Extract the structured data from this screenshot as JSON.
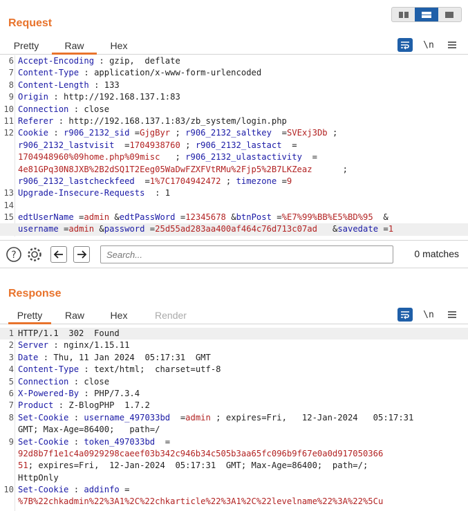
{
  "layout": {
    "icons": [
      "columns-icon",
      "rows-icon",
      "single-pane-icon"
    ]
  },
  "request": {
    "title": "Request",
    "tabs": [
      "Pretty",
      "Raw",
      "Hex"
    ],
    "active_tab": "Raw",
    "tools": {
      "newline": "\\n"
    },
    "lines": [
      {
        "n": "6",
        "parts": [
          [
            "hn",
            "Accept-Encoding"
          ],
          [
            "val",
            " : gzip,  deflate"
          ]
        ]
      },
      {
        "n": "7",
        "parts": [
          [
            "hn",
            "Content-Type"
          ],
          [
            "val",
            " : application/x-www-form-urlencoded"
          ]
        ]
      },
      {
        "n": "8",
        "parts": [
          [
            "hn",
            "Content-Length"
          ],
          [
            "val",
            " : 133"
          ]
        ]
      },
      {
        "n": "9",
        "parts": [
          [
            "hn",
            "Origin"
          ],
          [
            "val",
            " : http://192.168.137.1:83"
          ]
        ]
      },
      {
        "n": "10",
        "parts": [
          [
            "hn",
            "Connection"
          ],
          [
            "val",
            " : close"
          ]
        ]
      },
      {
        "n": "11",
        "parts": [
          [
            "hn",
            "Referer"
          ],
          [
            "val",
            " : http://192.168.137.1:83/zb_system/login.php"
          ]
        ]
      },
      {
        "n": "12",
        "parts": [
          [
            "hn",
            "Cookie"
          ],
          [
            "val",
            " : "
          ],
          [
            "ck",
            "r906_2132_sid"
          ],
          [
            "val",
            " ="
          ],
          [
            "cv",
            "GjgByr"
          ],
          [
            "val",
            " ; "
          ],
          [
            "ck",
            "r906_2132_saltkey"
          ],
          [
            "val",
            "  ="
          ],
          [
            "cv",
            "SVExj3Db"
          ],
          [
            "val",
            " ;"
          ]
        ]
      },
      {
        "n": "",
        "parts": [
          [
            "ck",
            "r906_2132_lastvisit"
          ],
          [
            "val",
            "  ="
          ],
          [
            "cv",
            "1704938760"
          ],
          [
            "val",
            " ; "
          ],
          [
            "ck",
            "r906_2132_lastact"
          ],
          [
            "val",
            "  ="
          ]
        ]
      },
      {
        "n": "",
        "parts": [
          [
            "cv",
            "1704948960%09home.php%09misc"
          ],
          [
            "val",
            "   ; "
          ],
          [
            "ck",
            "r906_2132_ulastactivity"
          ],
          [
            "val",
            "  ="
          ]
        ]
      },
      {
        "n": "",
        "parts": [
          [
            "cv",
            "4e81GPq30N8JXB%2B2dSQ1T2Eeg05WaDwFZXFVtRMu%2Fjp5%2B7LKZeaz"
          ],
          [
            "val",
            "      ;"
          ]
        ]
      },
      {
        "n": "",
        "parts": [
          [
            "ck",
            "r906_2132_lastcheckfeed"
          ],
          [
            "val",
            "  ="
          ],
          [
            "cv",
            "1%7C1704942472"
          ],
          [
            "val",
            " ; "
          ],
          [
            "ck",
            "timezone"
          ],
          [
            "val",
            " ="
          ],
          [
            "cv",
            "9"
          ]
        ]
      },
      {
        "n": "13",
        "parts": [
          [
            "hn",
            "Upgrade-Insecure-Requests"
          ],
          [
            "val",
            "  : 1"
          ]
        ]
      },
      {
        "n": "14",
        "parts": [
          [
            "val",
            ""
          ]
        ]
      },
      {
        "n": "15",
        "parts": [
          [
            "ck",
            "edtUserName"
          ],
          [
            "val",
            " ="
          ],
          [
            "cv",
            "admin"
          ],
          [
            "val",
            " &"
          ],
          [
            "ck",
            "edtPassWord"
          ],
          [
            "val",
            " ="
          ],
          [
            "cv",
            "12345678"
          ],
          [
            "val",
            " &"
          ],
          [
            "ck",
            "btnPost"
          ],
          [
            "val",
            " ="
          ],
          [
            "cv",
            "%E7%99%BB%E5%BD%95"
          ],
          [
            "val",
            "  &"
          ]
        ]
      },
      {
        "n": "",
        "hl": true,
        "parts": [
          [
            "ck",
            "username"
          ],
          [
            "val",
            " ="
          ],
          [
            "cv",
            "admin"
          ],
          [
            "val",
            " &"
          ],
          [
            "ck",
            "password"
          ],
          [
            "val",
            " ="
          ],
          [
            "cv",
            "25d55ad283aa400af464c76d713c07ad"
          ],
          [
            "val",
            "   &"
          ],
          [
            "ck",
            "savedate"
          ],
          [
            "val",
            " ="
          ],
          [
            "cv",
            "1"
          ]
        ]
      }
    ]
  },
  "search": {
    "placeholder": "Search...",
    "matches": "0 matches"
  },
  "response": {
    "title": "Response",
    "tabs": [
      "Pretty",
      "Raw",
      "Hex",
      "Render"
    ],
    "active_tab": "Pretty",
    "tools": {
      "newline": "\\n"
    },
    "lines": [
      {
        "n": "1",
        "hl": true,
        "parts": [
          [
            "val",
            "HTTP/1.1  302  Found"
          ]
        ]
      },
      {
        "n": "2",
        "parts": [
          [
            "hn",
            "Server"
          ],
          [
            "val",
            " : nginx/1.15.11"
          ]
        ]
      },
      {
        "n": "3",
        "parts": [
          [
            "hn",
            "Date"
          ],
          [
            "val",
            " : Thu, 11 Jan 2024  05:17:31  GMT"
          ]
        ]
      },
      {
        "n": "4",
        "parts": [
          [
            "hn",
            "Content-Type"
          ],
          [
            "val",
            " : text/html;  charset=utf-8"
          ]
        ]
      },
      {
        "n": "5",
        "parts": [
          [
            "hn",
            "Connection"
          ],
          [
            "val",
            " : close"
          ]
        ]
      },
      {
        "n": "6",
        "parts": [
          [
            "hn",
            "X-Powered-By"
          ],
          [
            "val",
            " : PHP/7.3.4"
          ]
        ]
      },
      {
        "n": "7",
        "parts": [
          [
            "hn",
            "Product"
          ],
          [
            "val",
            " : Z-BlogPHP  1.7.2"
          ]
        ]
      },
      {
        "n": "8",
        "parts": [
          [
            "hn",
            "Set-Cookie"
          ],
          [
            "val",
            " : "
          ],
          [
            "ck",
            "username_497033bd"
          ],
          [
            "val",
            "  ="
          ],
          [
            "cv",
            "admin"
          ],
          [
            "val",
            " ; expires=Fri,   12-Jan-2024   05:17:31"
          ]
        ]
      },
      {
        "n": "",
        "parts": [
          [
            "val",
            "GMT; Max-Age=86400;   path=/"
          ]
        ]
      },
      {
        "n": "9",
        "parts": [
          [
            "hn",
            "Set-Cookie"
          ],
          [
            "val",
            " : "
          ],
          [
            "ck",
            "token_497033bd"
          ],
          [
            "val",
            "  ="
          ]
        ]
      },
      {
        "n": "",
        "parts": [
          [
            "cv",
            "92d8b7f1e1c4a0929298caeef03b342c946b34c505b3aa65fc096b9f67e0a0d917050366"
          ]
        ]
      },
      {
        "n": "",
        "parts": [
          [
            "cv",
            "51"
          ],
          [
            "val",
            "; expires=Fri,  12-Jan-2024  05:17:31  GMT; Max-Age=86400;  path=/;"
          ]
        ]
      },
      {
        "n": "",
        "parts": [
          [
            "val",
            "HttpOnly"
          ]
        ]
      },
      {
        "n": "10",
        "parts": [
          [
            "hn",
            "Set-Cookie"
          ],
          [
            "val",
            " : "
          ],
          [
            "ck",
            "addinfo"
          ],
          [
            "val",
            " ="
          ]
        ]
      },
      {
        "n": "",
        "parts": [
          [
            "cv",
            "%7B%22chkadmin%22%3A1%2C%22chkarticle%22%3A1%2C%22levelname%22%3A%22%5Cu"
          ]
        ]
      }
    ]
  }
}
